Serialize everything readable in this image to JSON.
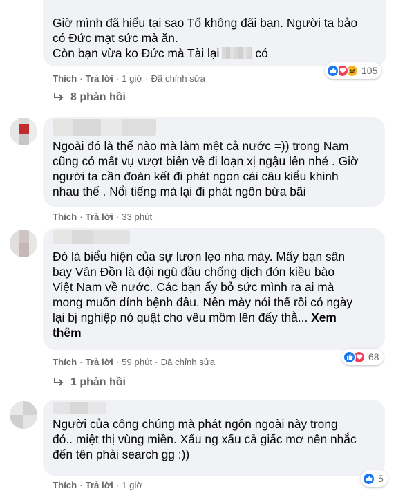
{
  "comments": [
    {
      "lines": [
        "Giờ mình đã hiểu tại sao Tổ không đãi bạn. Người ta bảo",
        "có Đức mạt sức mà ăn.",
        "Còn bạn vừa ko Đức mà Tài lại"
      ],
      "line3_tail": "có",
      "actions": {
        "like": "Thích",
        "reply": "Trả lời",
        "time": "1 giờ",
        "edited": "Đã chỉnh sửa"
      },
      "reactions": {
        "types": [
          "like-icon",
          "love-icon",
          "haha-icon"
        ],
        "count": "105"
      },
      "replies_label": "8 phản hồi"
    },
    {
      "lines": [
        "Ngoài đó là thế nào mà làm mệt cả nước =)) trong Nam",
        "cũng có mất vụ vượt biên về đi loạn xị ngậu lên nhé . Giờ",
        "người ta cần đoàn kết đi phát ngon cái câu kiểu khinh",
        "nhau thế . Nổi tiếng mà lại đi phát ngôn bừa bãi"
      ],
      "actions": {
        "like": "Thích",
        "reply": "Trả lời",
        "time": "33 phút"
      }
    },
    {
      "lines": [
        "Đó là biểu hiện của sự lươn lẹo nha mày. Mấy bạn sân",
        "bay Vân Đồn là đội ngũ đầu chống dịch đón kiều bào",
        "Việt Nam về nước. Các bạn ấy bỏ sức mình ra ai mà",
        "mong muốn dính bệnh đâu. Nên mày nói thế rồi có ngày",
        "lại bị nghiệp nó quật cho vêu mồm lên đấy thằ..."
      ],
      "see_more": "Xem thêm",
      "see_more_a": "Xem",
      "see_more_b": "thêm",
      "actions": {
        "like": "Thích",
        "reply": "Trả lời",
        "time": "59 phút",
        "edited": "Đã chỉnh sửa"
      },
      "reactions": {
        "types": [
          "like-icon",
          "love-icon"
        ],
        "count": "68"
      },
      "replies_label": "1 phản hồi"
    },
    {
      "lines": [
        "Người của công chúng mà phát ngôn ngoài này trong",
        "đó.. miệt thị vùng miền. Xấu ng xấu cả giấc mơ nên nhắc",
        "đến tên phải search gg :))"
      ],
      "actions": {
        "like": "Thích",
        "reply": "Trả lời",
        "time": "1 giờ"
      },
      "reactions": {
        "types": [
          "like-icon"
        ],
        "count": "5"
      }
    }
  ],
  "colors": {
    "bubble": "#f0f2f5",
    "secondary_text": "#65676b",
    "like_blue": "#1877f2",
    "love_red": "#f33e58",
    "haha_yellow": "#f7b125"
  }
}
